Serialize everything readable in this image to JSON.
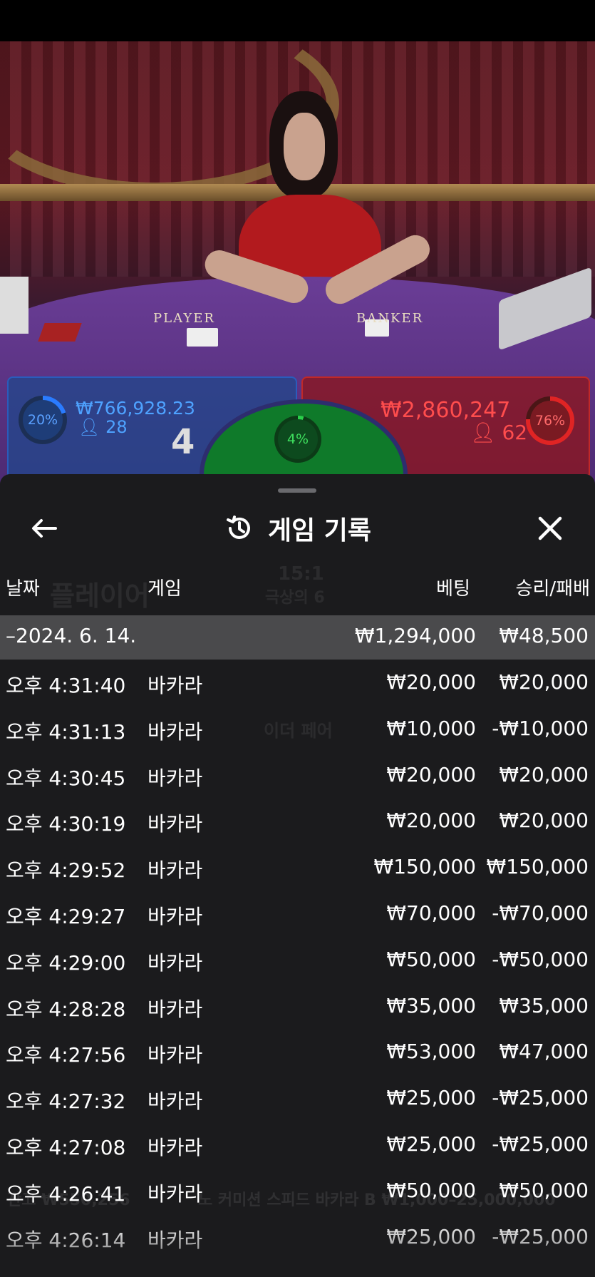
{
  "video": {
    "table_labels": {
      "player": "PLAYER",
      "banker": "BANKER"
    },
    "player": {
      "percent": "20%",
      "amount": "₩766,928.23",
      "count": "28",
      "score": "4"
    },
    "tie": {
      "percent": "4%"
    },
    "banker": {
      "percent": "76%",
      "amount": "₩2,860,247",
      "count": "62"
    }
  },
  "sheet": {
    "title": "게임 기록",
    "icons": {
      "back": "arrow-left-icon",
      "history": "history-icon",
      "close": "close-icon"
    },
    "columns": {
      "date": "날짜",
      "game": "게임",
      "bet": "베팅",
      "result": "승리/패배"
    },
    "summary": {
      "date": "–2024. 6. 14.",
      "bet": "₩1,294,000",
      "result": "₩48,500"
    },
    "rows": [
      {
        "time": "오후 4:31:40",
        "game": "바카라",
        "bet": "₩20,000",
        "result": "₩20,000"
      },
      {
        "time": "오후 4:31:13",
        "game": "바카라",
        "bet": "₩10,000",
        "result": "-₩10,000"
      },
      {
        "time": "오후 4:30:45",
        "game": "바카라",
        "bet": "₩20,000",
        "result": "₩20,000"
      },
      {
        "time": "오후 4:30:19",
        "game": "바카라",
        "bet": "₩20,000",
        "result": "₩20,000"
      },
      {
        "time": "오후 4:29:52",
        "game": "바카라",
        "bet": "₩150,000",
        "result": "₩150,000"
      },
      {
        "time": "오후 4:29:27",
        "game": "바카라",
        "bet": "₩70,000",
        "result": "-₩70,000"
      },
      {
        "time": "오후 4:29:00",
        "game": "바카라",
        "bet": "₩50,000",
        "result": "-₩50,000"
      },
      {
        "time": "오후 4:28:28",
        "game": "바카라",
        "bet": "₩35,000",
        "result": "₩35,000"
      },
      {
        "time": "오후 4:27:56",
        "game": "바카라",
        "bet": "₩53,000",
        "result": "₩47,000"
      },
      {
        "time": "오후 4:27:32",
        "game": "바카라",
        "bet": "₩25,000",
        "result": "-₩25,000"
      },
      {
        "time": "오후 4:27:08",
        "game": "바카라",
        "bet": "₩25,000",
        "result": "-₩25,000"
      },
      {
        "time": "오후 4:26:41",
        "game": "바카라",
        "bet": "₩50,000",
        "result": "₩50,000"
      },
      {
        "time": "오후 4:26:14",
        "game": "바카라",
        "bet": "₩25,000",
        "result": "-₩25,000"
      }
    ]
  },
  "background_ghost": {
    "player_label": "플레이어",
    "odds": "15:1",
    "odds_label": "극상의 6",
    "either_pair": "이더 페어",
    "balance": "잔고 ₩550,256",
    "table_name": "노 커미션 스피드 바카라 B ₩1,000–25,000,000"
  },
  "colors": {
    "sheet_bg": "#1b1b1d",
    "summary_bg": "#4a4a4c",
    "player_blue": "#4ea2ff",
    "banker_red": "#ff4d4d",
    "tie_green": "#3ee05e"
  }
}
